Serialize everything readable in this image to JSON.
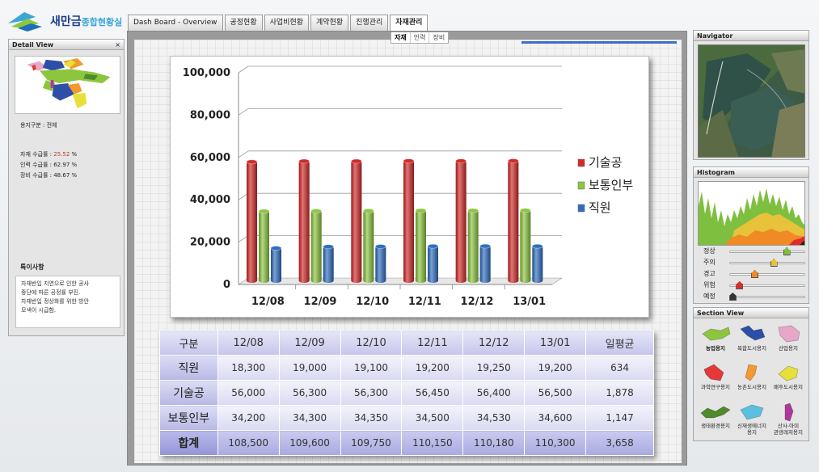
{
  "app": {
    "logo_title": "새만금",
    "logo_subtitle": "종합현황실"
  },
  "top_tabs": [
    {
      "label": "Dash Board - Overview"
    },
    {
      "label": "공정현황"
    },
    {
      "label": "사업비현황"
    },
    {
      "label": "계약현황"
    },
    {
      "label": "진행관리"
    },
    {
      "label": "자재관리"
    }
  ],
  "active_tab": "자재관리",
  "sub_tabs": [
    {
      "label": "자재"
    },
    {
      "label": "인력"
    },
    {
      "label": "장비"
    }
  ],
  "detail_view": {
    "title": "Detail View",
    "close": "×",
    "land_label": "용지구분 : 전체",
    "material_rate_label": "자재 수급률 : ",
    "material_rate_value": "25.52",
    "labor_rate_label": "인력 수급률 : 62.97 %",
    "equipment_rate_label": "장비 수급률 : 48.67 %",
    "percent": " %",
    "notice_title": "특이사항",
    "notice_text": "자재반입 지연으로 인한 공사\n중단에 따른 공정률 부진.\n자재반입 정상화를 위한 방안\n모색이 시급함."
  },
  "navigator": {
    "title": "Navigator"
  },
  "histogram": {
    "title": "Histogram",
    "levels": [
      {
        "label": "정상",
        "value": 0.74,
        "color": "#7fbf3f"
      },
      {
        "label": "주의",
        "value": 0.57,
        "color": "#e8c23a"
      },
      {
        "label": "경고",
        "value": 0.32,
        "color": "#f08a24"
      },
      {
        "label": "위험",
        "value": 0.12,
        "color": "#e02b2b"
      },
      {
        "label": "예정",
        "value": 0.03,
        "color": "#333333"
      }
    ]
  },
  "section_view": {
    "title": "Section View",
    "items": [
      {
        "label": "농업용지",
        "color": "#8cc63f",
        "selected": true
      },
      {
        "label": "복합도시용지",
        "color": "#2e4fa8",
        "selected": false
      },
      {
        "label": "산업용지",
        "color": "#e7a7c8",
        "selected": false
      },
      {
        "label": "과학연구용지",
        "color": "#e33939",
        "selected": false
      },
      {
        "label": "농촌도시용지",
        "color": "#f29a2e",
        "selected": false
      },
      {
        "label": "배후도시용지",
        "color": "#e8e03a",
        "selected": false
      },
      {
        "label": "생태환경용지",
        "color": "#4f8a2b",
        "selected": false
      },
      {
        "label": "신재생에너지\n용지",
        "color": "#5bc0de",
        "selected": false
      },
      {
        "label": "산사-아미\n관광레저용지",
        "color": "#b0379a",
        "selected": false
      }
    ]
  },
  "chart_data": {
    "type": "bar",
    "categories": [
      "12/08",
      "12/09",
      "12/10",
      "12/11",
      "12/12",
      "13/01"
    ],
    "series": [
      {
        "name": "기술공",
        "color": "#d42a2a",
        "values": [
          56000,
          56300,
          56300,
          56450,
          56400,
          56500
        ]
      },
      {
        "name": "보통인부",
        "color": "#8cc63f",
        "values": [
          34200,
          34300,
          34350,
          34500,
          34530,
          34600
        ]
      },
      {
        "name": "직원",
        "color": "#2f6fc1",
        "values": [
          18300,
          19000,
          19100,
          19200,
          19250,
          19200
        ]
      }
    ],
    "ylim": [
      0,
      100000
    ],
    "yticks": [
      "0",
      "20,000",
      "40,000",
      "60,000",
      "80,000",
      "100,000"
    ],
    "legend": "right",
    "grid": true
  },
  "table": {
    "header": [
      "구분",
      "12/08",
      "12/09",
      "12/10",
      "12/11",
      "12/12",
      "13/01",
      "일평균"
    ],
    "rows": [
      [
        "직원",
        "18,300",
        "19,000",
        "19,100",
        "19,200",
        "19,250",
        "19,200",
        "634"
      ],
      [
        "기술공",
        "56,000",
        "56,300",
        "56,300",
        "56,450",
        "56,400",
        "56,500",
        "1,878"
      ],
      [
        "보통인부",
        "34,200",
        "34,300",
        "34,350",
        "34,500",
        "34,530",
        "34,600",
        "1,147"
      ],
      [
        "합계",
        "108,500",
        "109,600",
        "109,750",
        "110,150",
        "110,180",
        "110,300",
        "3,658"
      ]
    ]
  }
}
